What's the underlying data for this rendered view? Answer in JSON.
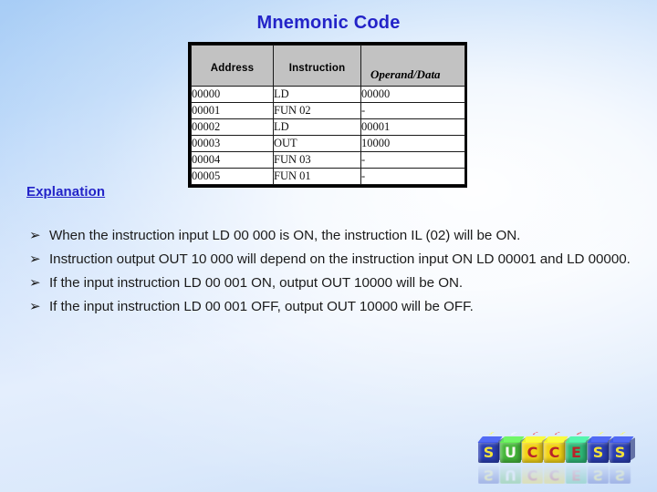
{
  "slide": {
    "title": "Mnemonic Code",
    "background_top_color": "#a8cdf6",
    "background_bottom_color": "#c9def9",
    "title_color": "#2323c8"
  },
  "table": {
    "headers": {
      "address": "Address",
      "instruction": "Instruction",
      "operand": "Operand/Data"
    },
    "header_background": "#c2c2c2",
    "rows": [
      {
        "address": "00000",
        "instruction": "LD",
        "operand": "00000"
      },
      {
        "address": "00001",
        "instruction": "FUN 02",
        "operand": "-"
      },
      {
        "address": "00002",
        "instruction": "LD",
        "operand": "00001"
      },
      {
        "address": "00003",
        "instruction": "OUT",
        "operand": "10000"
      },
      {
        "address": "00004",
        "instruction": "FUN 03",
        "operand": "-"
      },
      {
        "address": "00005",
        "instruction": "FUN 01",
        "operand": "-"
      }
    ]
  },
  "explanation": {
    "heading": "Explanation",
    "bullet_marker": "➢",
    "items": [
      "When the instruction input LD 00 000 is ON, the instruction IL (02) will be ON.",
      "Instruction output OUT 10 000 will depend on the instruction input ON LD 00001 and LD 00000.",
      "If the input instruction LD 00 001 ON, output OUT 10000 will be ON.",
      "If the input instruction LD 00 001 OFF, output OUT 10000 will be OFF."
    ]
  },
  "logo": {
    "word": "SUCCESS",
    "blocks": [
      {
        "letter": "S",
        "block_color": "#2b3fb4",
        "letter_color": "#f2e23a",
        "mini_letter": "s",
        "mini_color": "#f2e23a"
      },
      {
        "letter": "U",
        "block_color": "#46b83a",
        "letter_color": "#f7f7ef",
        "mini_letter": "u",
        "mini_color": "#f7f7ef"
      },
      {
        "letter": "C",
        "block_color": "#f2d316",
        "letter_color": "#b8232a",
        "mini_letter": "c",
        "mini_color": "#b8232a"
      },
      {
        "letter": "C",
        "block_color": "#f2d316",
        "letter_color": "#b8232a",
        "mini_letter": "c",
        "mini_color": "#b8232a"
      },
      {
        "letter": "E",
        "block_color": "#2eb877",
        "letter_color": "#b8232a",
        "mini_letter": "e",
        "mini_color": "#b8232a"
      },
      {
        "letter": "S",
        "block_color": "#2b3fb4",
        "letter_color": "#f2e23a",
        "mini_letter": "s",
        "mini_color": "#f2e23a"
      },
      {
        "letter": "S",
        "block_color": "#2b3fb4",
        "letter_color": "#f2e23a",
        "mini_letter": "s",
        "mini_color": "#f2e23a"
      }
    ]
  }
}
